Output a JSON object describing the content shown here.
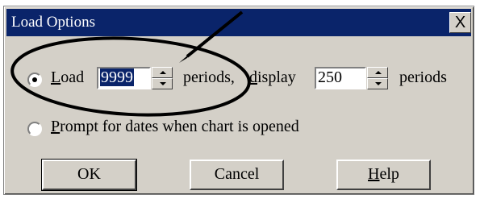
{
  "window": {
    "title": "Load Options",
    "close_label": "X"
  },
  "option_load": {
    "selected": true,
    "label_prefix_underlined": "L",
    "label_rest": "oad",
    "periods_value": "9999",
    "periods_label": "periods,",
    "display_prefix_underlined": "d",
    "display_rest": "isplay",
    "display_value": "250",
    "display_unit": "periods"
  },
  "option_prompt": {
    "selected": false,
    "label_prefix_underlined": "P",
    "label_rest": "rompt for dates when chart is opened"
  },
  "buttons": {
    "ok": "OK",
    "cancel": "Cancel",
    "help_prefix_underlined": "H",
    "help_rest": "elp"
  },
  "colors": {
    "titlebar": "#0a246a",
    "face": "#d4d0c8",
    "annotation": "#000000"
  }
}
